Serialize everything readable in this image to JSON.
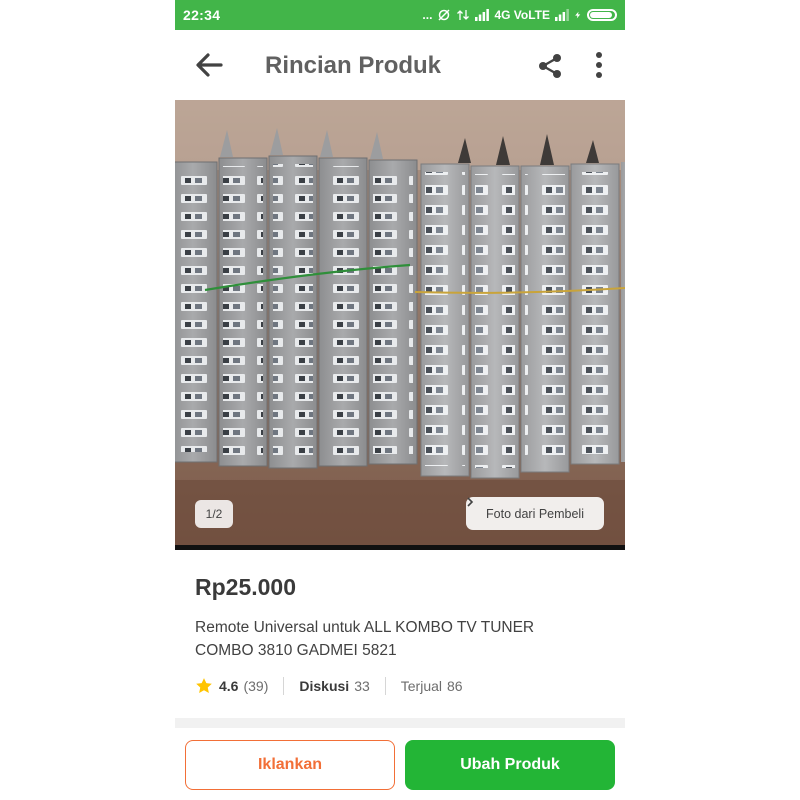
{
  "status_bar": {
    "time": "22:34",
    "network": "4G VoLTE",
    "dots": "...",
    "battery_level": 0.9,
    "background_color": "#42b549"
  },
  "app_bar": {
    "title": "Rincian Produk",
    "icons": [
      "arrow-left-icon",
      "share-icon",
      "more-vert-icon"
    ]
  },
  "product_image": {
    "page_indicator": "1/2",
    "buyer_photo_label": "Foto dari Pembeli",
    "chevron_icon": "chevron-right-icon"
  },
  "product": {
    "price": "Rp25.000",
    "title_lines": [
      "Remote Universal untuk ALL KOMBO TV TUNER",
      "COMBO 3810 GADMEI 5821"
    ],
    "rating": "4.6",
    "rating_count": "(39)",
    "discussion_label": "Diskusi",
    "discussion_count": "33",
    "sold_label": "Terjual",
    "sold_count": "86",
    "star_color": "#ffc400"
  },
  "actions": {
    "advertise_label": "Iklankan",
    "edit_label": "Ubah Produk",
    "advertise_color": "#f26f37",
    "edit_color": "#23b536"
  }
}
